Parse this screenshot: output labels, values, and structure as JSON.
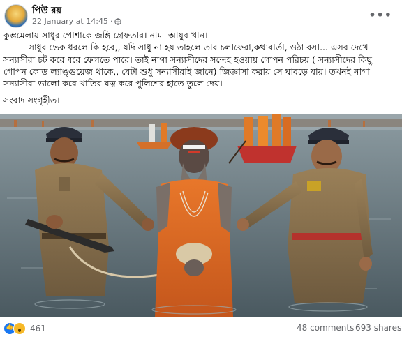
{
  "post": {
    "author": "পিউ রয়",
    "date": "22 January at 14:45",
    "dot": "·",
    "text_lines": [
      "কুম্ভমেলায় সাধুর পোশাকে জঙ্গি গ্রেফতার। নাম- আয়ুব খান।",
      "         সাধুর ভেক ধরলে কি হবে,, যদি সাধু না হয় তাহলে তার চলাফেরা,কথাবার্তা, ওঠা বসা... এসব দেখে",
      "সন্যাসীরা চট করে ধরে ফেলতে পারে। তাই নাগা সন্যাসীদের সন্দেহ হওয়ায় গোপন পরিচয় ( সন্যাসীদের কিছু",
      "গোপন কোড ল্যাঙ্গুয়েজ থাকে,, যেটা শুধু সন্যাসীরাই জানে) জিজ্ঞাসা করায় সে ঘাবড়ে যায়। তখনই নাগা",
      "সন্যাসীরা ভালো করে খাতির যত্ন করে পুলিশের হাতে তুলে দেয়।"
    ],
    "closing_line": "সংবাদ সংগৃহীত।"
  },
  "footer": {
    "reaction_count": "461",
    "comments": "48 comments",
    "shares": "693 shares"
  },
  "icons": {
    "more": "more-options-icon",
    "close": "close-icon",
    "globe": "globe-icon"
  },
  "colors": {
    "accent": "#1877f2",
    "meta_text": "#65676b"
  }
}
